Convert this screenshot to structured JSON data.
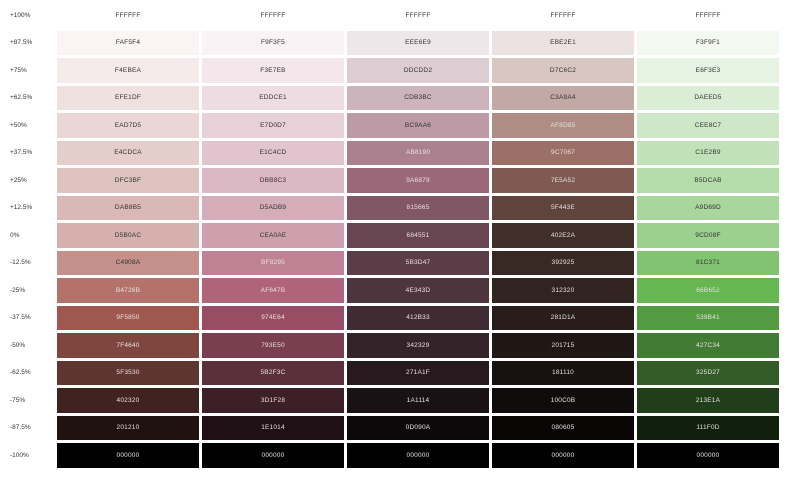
{
  "rows": [
    {
      "label": "+100%",
      "cells": [
        "FFFFFF",
        "FFFFFF",
        "FFFFFF",
        "FFFFFF",
        "FFFFFF"
      ]
    },
    {
      "label": "+87.5%",
      "cells": [
        "FAF5F4",
        "F9F3F5",
        "EEE6E9",
        "EBE2E1",
        "F3F9F1"
      ]
    },
    {
      "label": "+75%",
      "cells": [
        "F4EBEA",
        "F3E7EB",
        "DDCDD2",
        "D7C6C2",
        "E6F3E3"
      ]
    },
    {
      "label": "+62.5%",
      "cells": [
        "EFE1DF",
        "EDDCE1",
        "CDB3BC",
        "C3A9A4",
        "DAEED5"
      ]
    },
    {
      "label": "+50%",
      "cells": [
        "EAD7D5",
        "E7D0D7",
        "BC9AA6",
        "AF8D85",
        "CEE8C7"
      ]
    },
    {
      "label": "+37.5%",
      "cells": [
        "E4CDCA",
        "E1C4CD",
        "AB8190",
        "9C7067",
        "C1E2B9"
      ]
    },
    {
      "label": "+25%",
      "cells": [
        "DFC3BF",
        "DBB8C3",
        "9A6879",
        "7E5A52",
        "B5DCAB"
      ]
    },
    {
      "label": "+12.5%",
      "cells": [
        "DAB8B5",
        "D5ADB9",
        "815665",
        "5F443E",
        "A9D69D"
      ]
    },
    {
      "label": "0%",
      "cells": [
        "D5B0AC",
        "CEA0AE",
        "684551",
        "402E2A",
        "9CD08F"
      ]
    },
    {
      "label": "-12.5%",
      "cells": [
        "C4908A",
        "BF8295",
        "5B3D47",
        "392925",
        "81C371"
      ]
    },
    {
      "label": "-25%",
      "cells": [
        "B4726B",
        "AF647B",
        "4E343D",
        "312320",
        "66B652"
      ]
    },
    {
      "label": "-37.5%",
      "cells": [
        "9F5850",
        "974E64",
        "412B33",
        "281D1A",
        "539B41"
      ]
    },
    {
      "label": "-50%",
      "cells": [
        "7F4640",
        "793E50",
        "342329",
        "201715",
        "427C34"
      ]
    },
    {
      "label": "-62.5%",
      "cells": [
        "5F3530",
        "5B2F3C",
        "271A1F",
        "181110",
        "325D27"
      ]
    },
    {
      "label": "-75%",
      "cells": [
        "402320",
        "3D1F28",
        "1A1114",
        "100C0B",
        "213E1A"
      ]
    },
    {
      "label": "-87.5%",
      "cells": [
        "201210",
        "1E1014",
        "0D090A",
        "080605",
        "111F0D"
      ]
    },
    {
      "label": "-100%",
      "cells": [
        "000000",
        "000000",
        "000000",
        "000000",
        "000000"
      ]
    }
  ]
}
